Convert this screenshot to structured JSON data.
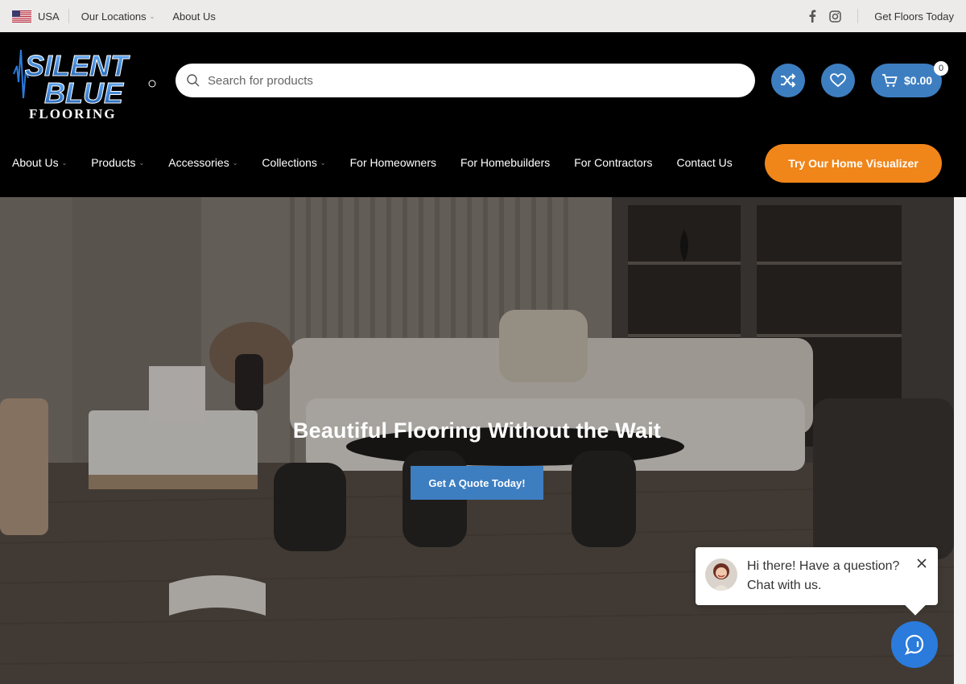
{
  "topbar": {
    "country": "USA",
    "locations": "Our Locations",
    "about": "About Us",
    "cta": "Get Floors Today"
  },
  "header": {
    "logo_alt": "Silent Blue Flooring",
    "logo_line1": "SILENT",
    "logo_line2": "BLUE",
    "logo_line3": "FLOORING",
    "search_placeholder": "Search for products",
    "cart_total": "$0.00",
    "cart_count": "0"
  },
  "nav": {
    "items": [
      {
        "label": "About Us",
        "dropdown": true
      },
      {
        "label": "Products",
        "dropdown": true
      },
      {
        "label": "Accessories",
        "dropdown": true
      },
      {
        "label": "Collections",
        "dropdown": true
      },
      {
        "label": "For Homeowners",
        "dropdown": false
      },
      {
        "label": "For Homebuilders",
        "dropdown": false
      },
      {
        "label": "For Contractors",
        "dropdown": false
      },
      {
        "label": "Contact Us",
        "dropdown": false
      }
    ],
    "visualizer_label": "Try Our Home Visualizer"
  },
  "hero": {
    "title": "Beautiful Flooring Without the Wait",
    "button_label": "Get A Quote Today!"
  },
  "chat": {
    "line1": "Hi there! Have a question?",
    "line2": "Chat with us."
  },
  "colors": {
    "brand_blue": "#3d7ec1",
    "orange": "#f08519",
    "chat_blue": "#2a7bdb"
  }
}
